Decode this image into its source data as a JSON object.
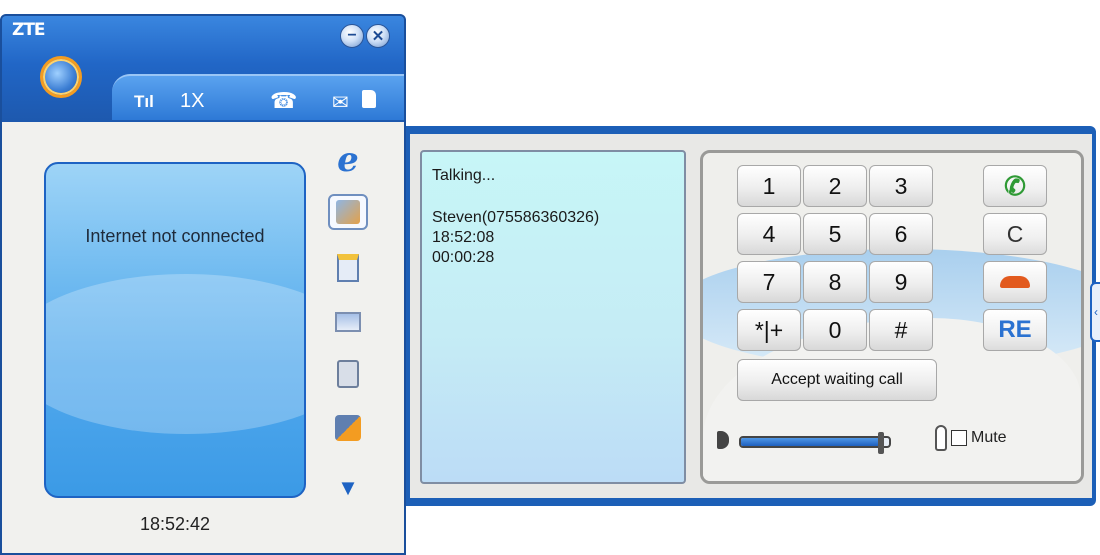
{
  "app": {
    "brand": "ZTE",
    "minimize_icon": "minimize-icon",
    "close_icon": "close-icon"
  },
  "status_bar": {
    "signal": "Tıl",
    "network_type": "1X",
    "icons": [
      "signal-icon",
      "phone-icon",
      "mail-icon",
      "sim-icon"
    ]
  },
  "screen": {
    "message": "Internet not connected",
    "clock": "18:52:42"
  },
  "side_nav": {
    "items": [
      "internet-icon",
      "contacts-icon",
      "notes-icon",
      "sms-icon",
      "phonebook-icon",
      "call-log-icon",
      "more-icon"
    ]
  },
  "call_info": {
    "status": "Talking...",
    "caller": "Steven(075586360326)",
    "start_time": "18:52:08",
    "duration": "00:00:28"
  },
  "dialpad": {
    "keys": [
      "1",
      "2",
      "3",
      "4",
      "5",
      "6",
      "7",
      "8",
      "9",
      "*|+",
      "0",
      "#"
    ],
    "accept_waiting": "Accept waiting call",
    "clear": "C",
    "redial": "RE",
    "mute_label": "Mute",
    "volume_level": 0.95
  },
  "colors": {
    "frame_blue": "#1c5fb7",
    "call_green": "#2f9a35",
    "hangup_orange": "#e25a1e"
  }
}
